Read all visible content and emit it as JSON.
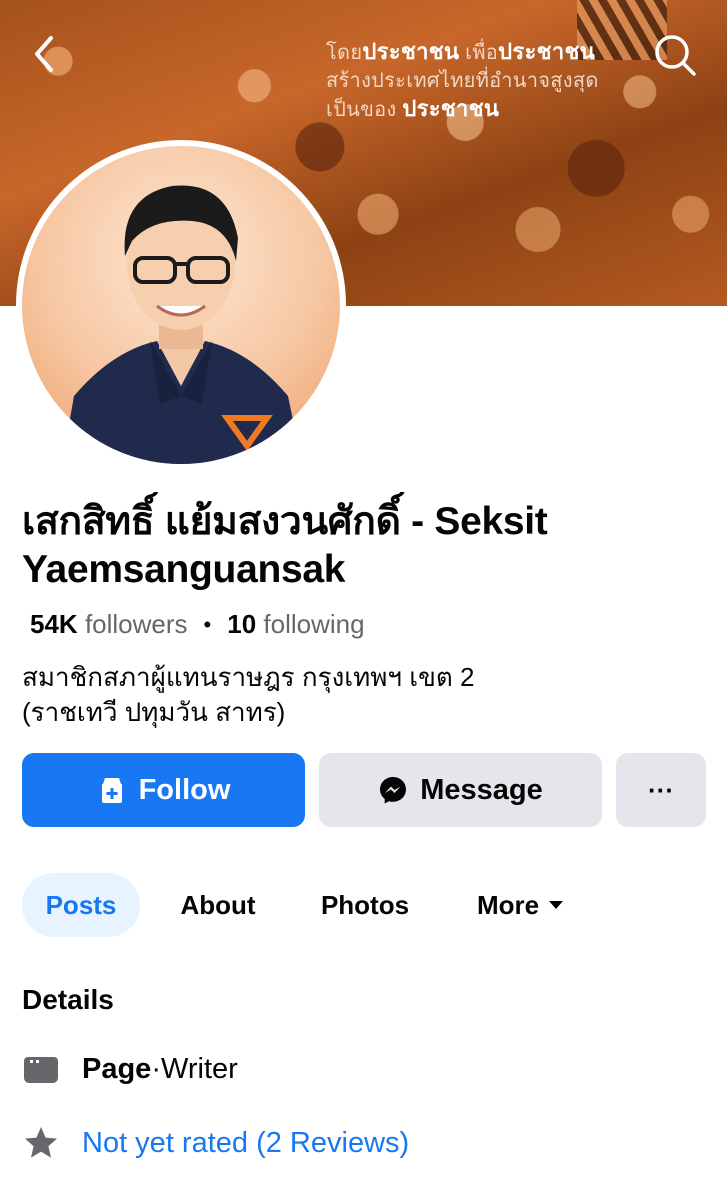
{
  "cover": {
    "slogan_line1_a": "โดย",
    "slogan_line1_b": "ประชาชน",
    "slogan_line1_c": " เพื่อ",
    "slogan_line1_d": "ประชาชน",
    "slogan_line2": "สร้างประเทศไทยที่อำนาจสูงสุด",
    "slogan_line3_a": "เป็นของ ",
    "slogan_line3_b": "ประชาชน"
  },
  "profile": {
    "name": "เสกสิทธิ์ แย้มสงวนศักดิ์ - Seksit Yaemsanguansak",
    "followers_count": "54K",
    "followers_label": "followers",
    "following_count": "10",
    "following_label": "following",
    "dot": "•",
    "bio_line1": "สมาชิกสภาผู้แทนราษฎร กรุงเทพฯ เขต 2",
    "bio_line2": "(ราชเทวี ปทุมวัน สาทร)"
  },
  "actions": {
    "follow_label": "Follow",
    "message_label": "Message",
    "more_label": "···"
  },
  "tabs": [
    {
      "label": "Posts",
      "active": true
    },
    {
      "label": "About"
    },
    {
      "label": "Photos"
    },
    {
      "label": "More"
    }
  ],
  "details": {
    "title": "Details",
    "page_label": "Page",
    "page_sep": " · ",
    "page_category": "Writer",
    "rating_text": "Not yet rated (2 Reviews)"
  },
  "colors": {
    "accent": "#1877f2",
    "button_grey": "#e4e6eb",
    "active_tab_bg": "#e7f3ff"
  },
  "icons": [
    "back-arrow-icon",
    "search-icon",
    "follow-page-icon",
    "messenger-icon",
    "page-flag-icon",
    "star-icon",
    "caret-down-icon"
  ]
}
